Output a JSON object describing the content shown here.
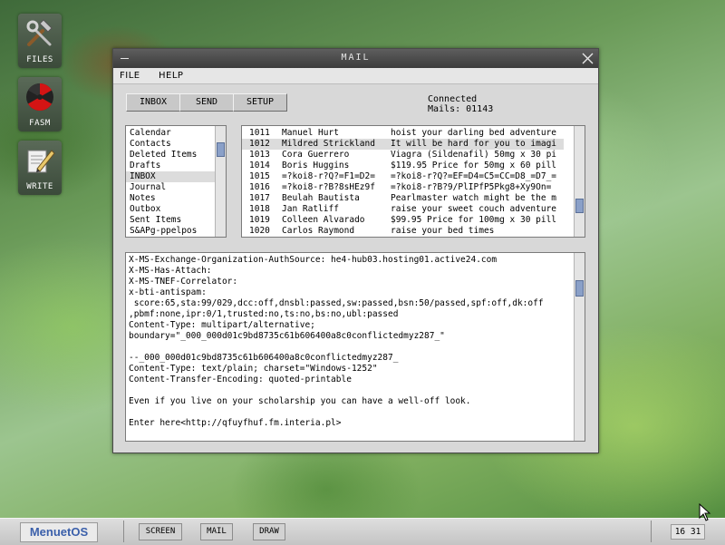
{
  "desktop": {
    "icons": [
      {
        "label": "FILES",
        "icon": "tools-icon"
      },
      {
        "label": "FASM",
        "icon": "radiation-icon"
      },
      {
        "label": "WRITE",
        "icon": "write-icon"
      }
    ]
  },
  "window": {
    "title": "MAIL",
    "menu": [
      "FILE",
      "HELP"
    ],
    "toolbar": [
      "INBOX",
      "SEND",
      "SETUP"
    ],
    "status": {
      "connection": "Connected",
      "mails": "Mails: 01143"
    }
  },
  "folders": {
    "items": [
      "Calendar",
      "Contacts",
      "Deleted Items",
      "Drafts",
      "INBOX",
      "Journal",
      "Notes",
      "Outbox",
      "Sent Items",
      "S&APg-ppelpos"
    ],
    "selected_index": 4
  },
  "messages": {
    "selected_index": 1,
    "rows": [
      {
        "num": "1011",
        "from": "Manuel Hurt",
        "subject": "hoist your darling bed adventure"
      },
      {
        "num": "1012",
        "from": "Mildred Strickland",
        "subject": "It will be hard for you to imagi"
      },
      {
        "num": "1013",
        "from": "Cora Guerrero",
        "subject": "Viagra (Sildenafil) 50mg x 30 pi"
      },
      {
        "num": "1014",
        "from": "Boris Huggins",
        "subject": "$119.95 Price for 50mg x 60 pill"
      },
      {
        "num": "1015",
        "from": "=?koi8-r?Q?=F1=D2=",
        "subject": "=?koi8-r?Q?=EF=D4=C5=CC=D8_=D7_="
      },
      {
        "num": "1016",
        "from": "=?koi8-r?B?8sHEz9f",
        "subject": "=?koi8-r?B?9/PlIPfP5Pkg8+Xy9On="
      },
      {
        "num": "1017",
        "from": "Beulah Bautista",
        "subject": "Pearlmaster watch might be the m"
      },
      {
        "num": "1018",
        "from": "Jan Ratliff",
        "subject": "raise your sweet couch adventure"
      },
      {
        "num": "1019",
        "from": "Colleen Alvarado",
        "subject": "$99.95 Price for 100mg x 30 pill"
      },
      {
        "num": "1020",
        "from": "Carlos Raymond",
        "subject": "raise your bed times"
      }
    ]
  },
  "message_body": {
    "lines": [
      "X-MS-Exchange-Organization-AuthSource: he4-hub03.hosting01.active24.com",
      "X-MS-Has-Attach:",
      "X-MS-TNEF-Correlator:",
      "x-bti-antispam:",
      " score:65,sta:99/029,dcc:off,dnsbl:passed,sw:passed,bsn:50/passed,spf:off,dk:off",
      ",pbmf:none,ipr:0/1,trusted:no,ts:no,bs:no,ubl:passed",
      "Content-Type: multipart/alternative;",
      "boundary=\"_000_000d01c9bd8735c61b606400a8c0conflictedmyz287_\"",
      "",
      "--_000_000d01c9bd8735c61b606400a8c0conflictedmyz287_",
      "Content-Type: text/plain; charset=\"Windows-1252\"",
      "Content-Transfer-Encoding: quoted-printable",
      "",
      "Even if you live on your scholarship you can have a well-off look.",
      "",
      "Enter here<http://qfuyfhuf.fm.interia.pl>"
    ]
  },
  "taskbar": {
    "start": "MenuetOS",
    "tasks": [
      "SCREEN",
      "MAIL",
      "DRAW"
    ],
    "clock": "16 31"
  }
}
